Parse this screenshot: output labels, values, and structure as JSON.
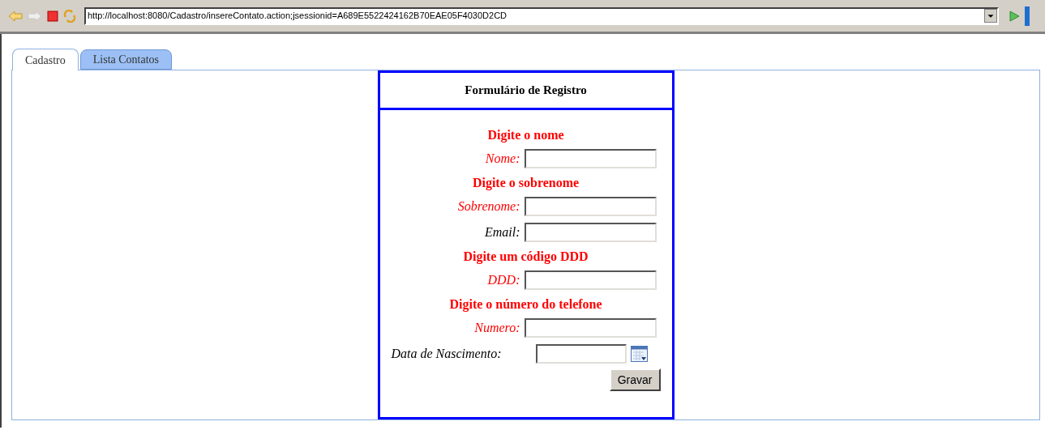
{
  "browser": {
    "url": "http://localhost:8080/Cadastro/insereContato.action;jsessionid=A689E5522424162B70EAE05F4030D2CD"
  },
  "tabs": [
    {
      "label": "Cadastro",
      "selected": true
    },
    {
      "label": "Lista Contatos",
      "selected": false
    }
  ],
  "form": {
    "title": "Formulário de Registro",
    "fields": [
      {
        "kind": "text",
        "label": "Nome:",
        "error": "Digite o nome",
        "invalid": true
      },
      {
        "kind": "text",
        "label": "Sobrenome:",
        "error": "Digite o sobrenome",
        "invalid": true
      },
      {
        "kind": "text",
        "label": "Email:",
        "invalid": false
      },
      {
        "kind": "text",
        "label": "DDD:",
        "error": "Digite um código DDD",
        "invalid": true
      },
      {
        "kind": "text",
        "label": "Numero:",
        "error": "Digite o número do telefone",
        "invalid": true
      },
      {
        "kind": "date",
        "label": "Data de Nascimento:",
        "invalid": false
      }
    ],
    "submit": "Gravar"
  }
}
